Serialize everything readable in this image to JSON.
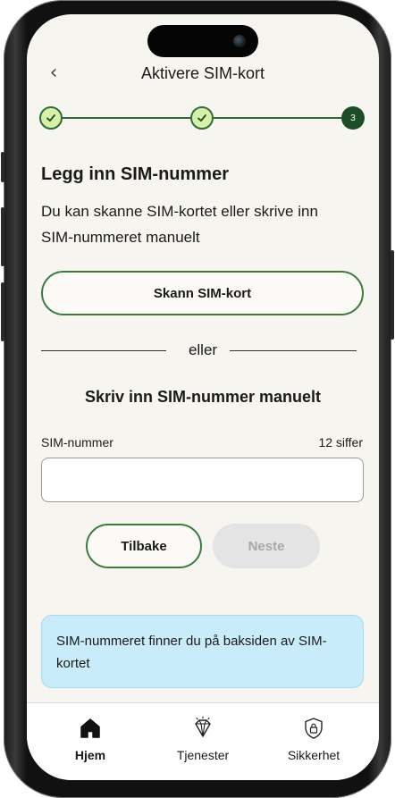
{
  "header": {
    "back_icon": "chevron-left-icon",
    "title": "Aktivere SIM-kort"
  },
  "stepper": {
    "steps": [
      {
        "state": "done",
        "icon": "check-icon"
      },
      {
        "state": "done",
        "icon": "check-icon"
      },
      {
        "state": "current",
        "label": "3"
      }
    ]
  },
  "main": {
    "title": "Legg inn SIM-nummer",
    "description": "Du kan skanne SIM-kortet eller skrive inn SIM-nummeret manuelt",
    "scan_button": "Skann SIM-kort",
    "divider_text": "eller",
    "manual_title": "Skriv inn SIM-nummer manuelt",
    "sim_field": {
      "label": "SIM-nummer",
      "hint": "12 siffer",
      "value": "",
      "placeholder": ""
    },
    "back_button": "Tilbake",
    "next_button": "Neste",
    "info_text": "SIM-nummeret finner du på baksiden av SIM-kortet"
  },
  "tabbar": {
    "tabs": [
      {
        "label": "Hjem",
        "icon": "home-icon",
        "active": true
      },
      {
        "label": "Tjenester",
        "icon": "diamond-icon",
        "active": false
      },
      {
        "label": "Sikkerhet",
        "icon": "shield-lock-icon",
        "active": false
      }
    ]
  },
  "colors": {
    "accent_green": "#2f6b3a",
    "step_done_fill": "#d6f0a8",
    "step_current_fill": "#1d4d28",
    "info_background": "#c9ecfa",
    "screen_background": "#f7f5f0",
    "disabled_button": "#e4e4e4"
  }
}
